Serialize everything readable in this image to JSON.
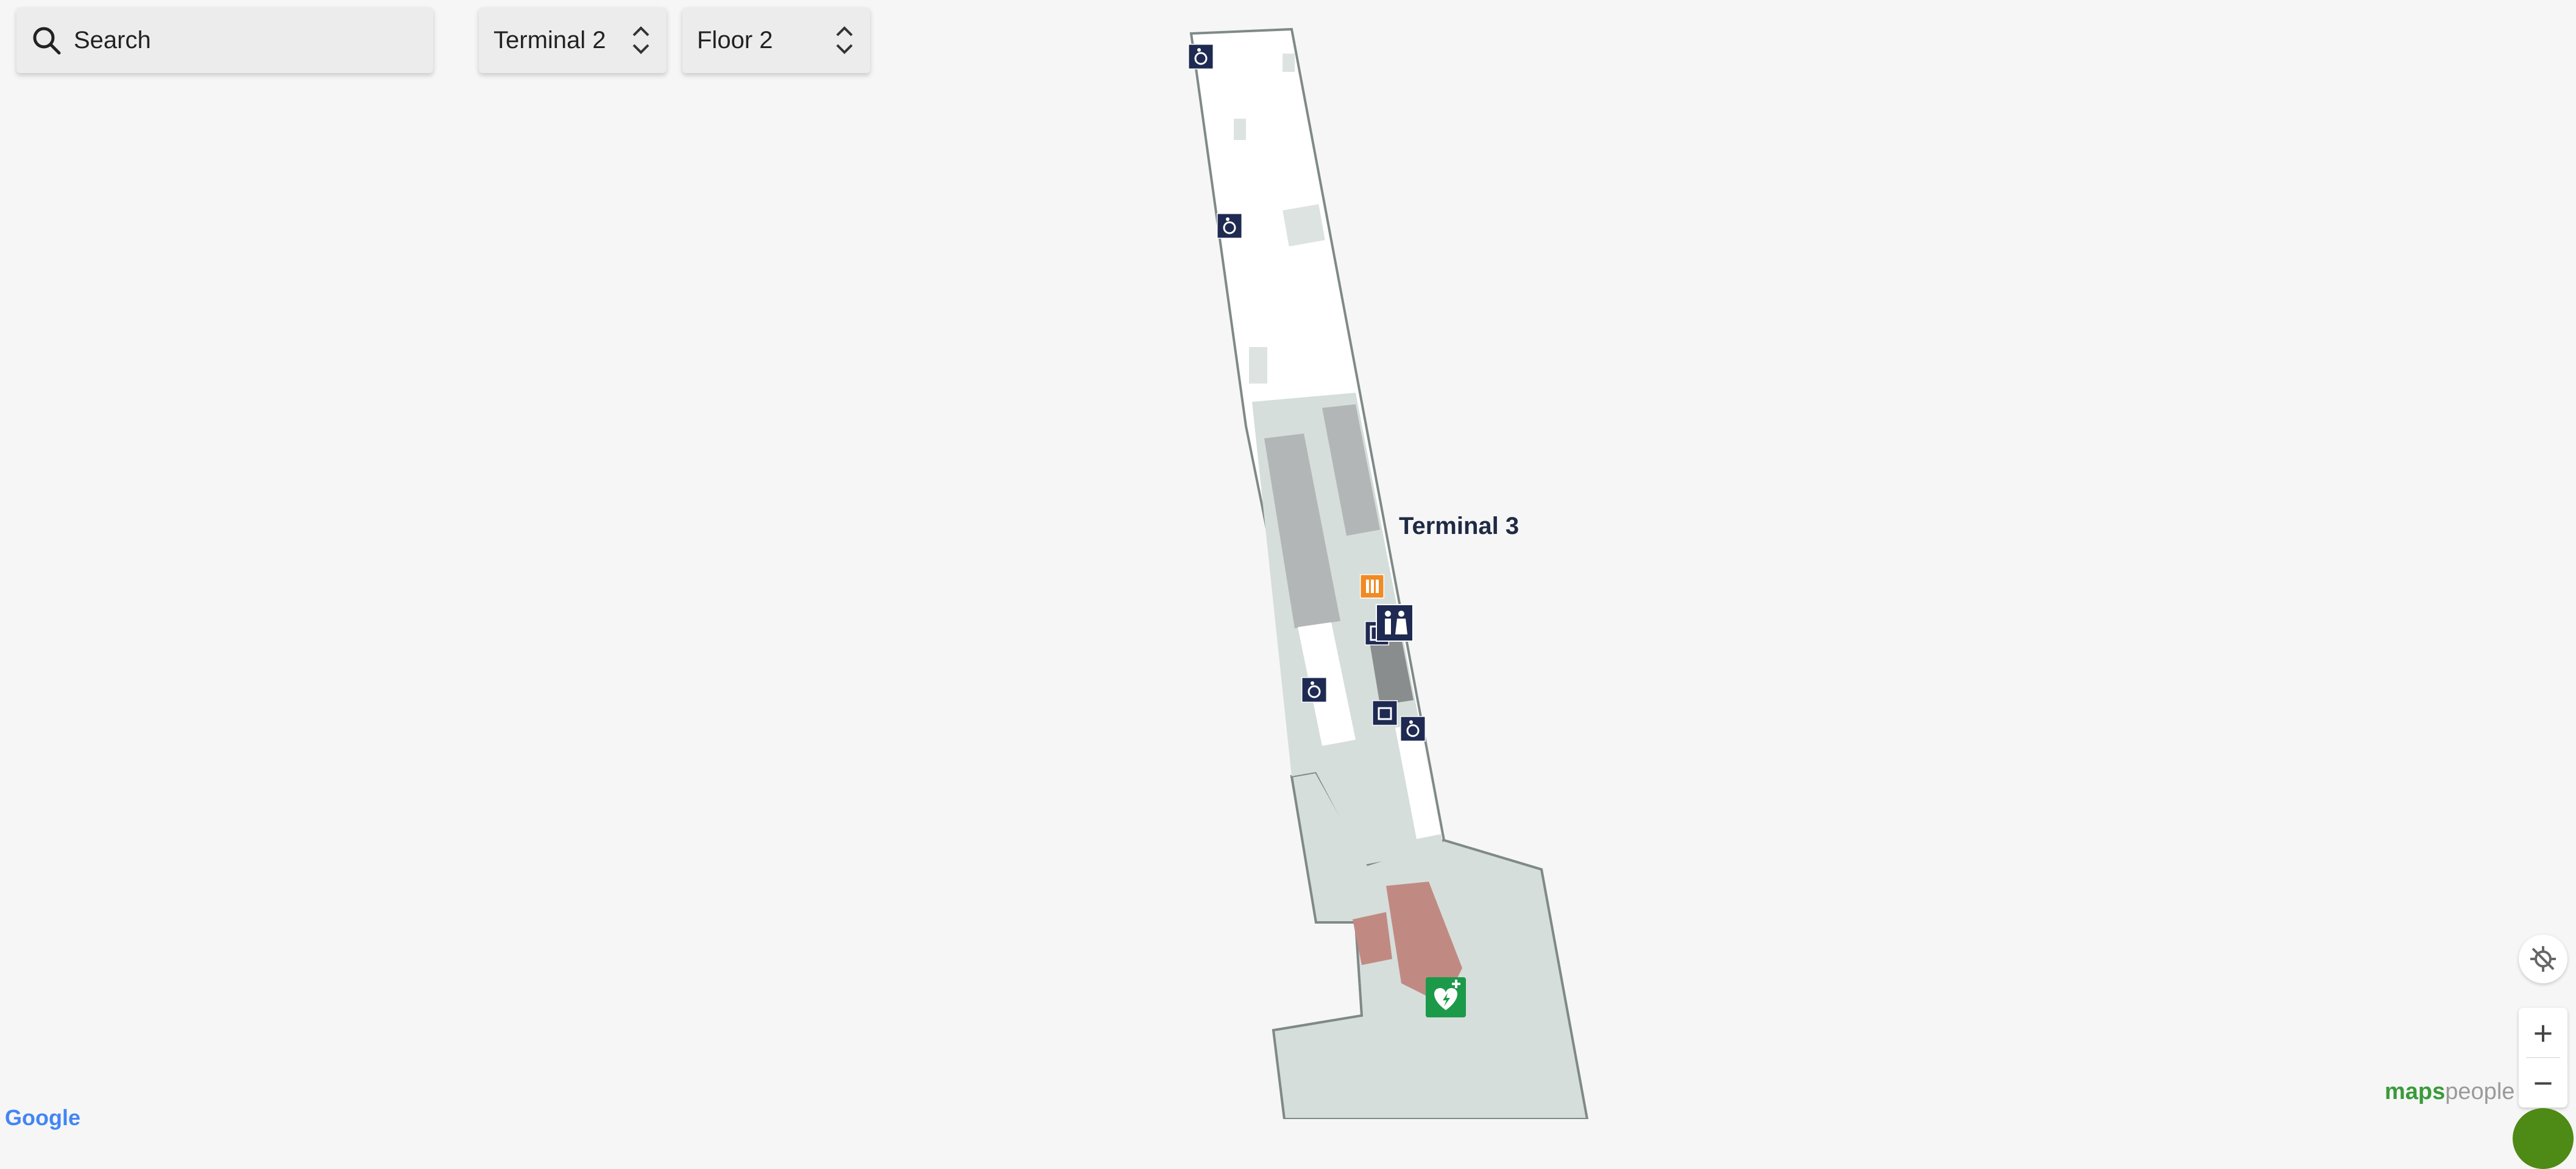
{
  "search": {
    "placeholder": "Search"
  },
  "building_selector": {
    "selected": "Terminal 2"
  },
  "floor_selector": {
    "selected": "Floor 2"
  },
  "map": {
    "location_label": "Terminal 3",
    "colors": {
      "background": "#f6f6f6",
      "room_white": "#ffffff",
      "corridor": "#d5dedb",
      "shop_dark": "#b3b6b6",
      "security_pink": "#c08a83",
      "icon_navy": "#1f2a52",
      "aed_green": "#1c9a4a",
      "info_orange": "#f08a24"
    },
    "icons": [
      "wheelchair-icon",
      "restroom-icon",
      "elevator-icon",
      "luggage-icon",
      "aed-icon"
    ]
  },
  "controls": {
    "zoom_in": "+",
    "zoom_out": "−"
  },
  "branding": {
    "maps": "maps",
    "people": "people",
    "google": "Google"
  }
}
